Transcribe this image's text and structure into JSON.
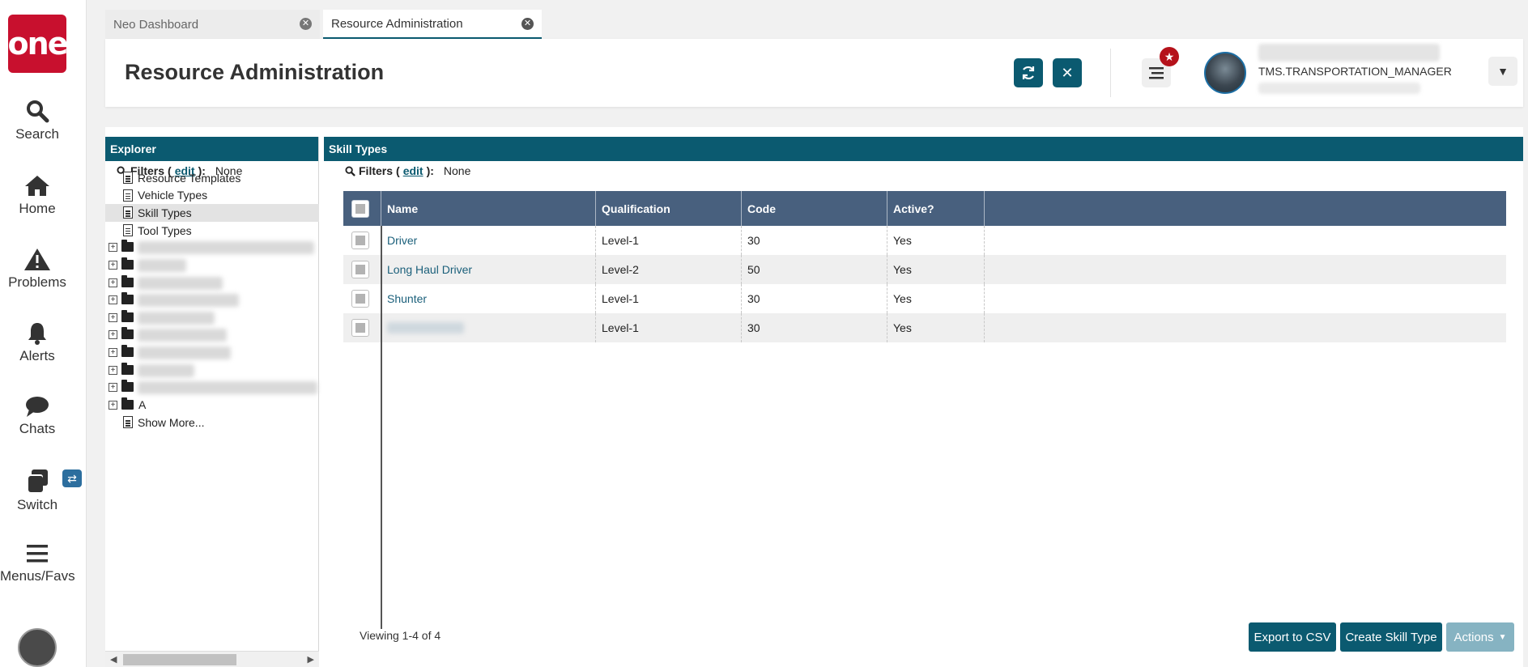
{
  "nav": {
    "logo": "one",
    "items": [
      {
        "label": "Search",
        "icon": "search-icon"
      },
      {
        "label": "Home",
        "icon": "home-icon"
      },
      {
        "label": "Problems",
        "icon": "warning-icon"
      },
      {
        "label": "Alerts",
        "icon": "bell-icon"
      },
      {
        "label": "Chats",
        "icon": "chat-icon"
      },
      {
        "label": "Switch",
        "icon": "switch-icon"
      },
      {
        "label": "Menus/Favs",
        "icon": "menu-icon"
      }
    ]
  },
  "tabs": [
    {
      "label": "Neo Dashboard",
      "active": false
    },
    {
      "label": "Resource Administration",
      "active": true
    }
  ],
  "header": {
    "title": "Resource Administration",
    "user_role": "TMS.TRANSPORTATION_MANAGER"
  },
  "explorer": {
    "title": "Explorer",
    "filters_label": "Filters",
    "filters_edit": "edit",
    "filters_value": "None",
    "items": [
      "Resource Templates",
      "Vehicle Types",
      "Skill Types",
      "Tool Types"
    ],
    "selected": "Skill Types",
    "folder_visible_label": "A",
    "show_more": "Show More..."
  },
  "skills": {
    "title": "Skill Types",
    "filters_label": "Filters",
    "filters_edit": "edit",
    "filters_value": "None",
    "columns": [
      "Name",
      "Qualification",
      "Code",
      "Active?"
    ],
    "rows": [
      {
        "name": "Driver",
        "qualification": "Level-1",
        "code": "30",
        "active": "Yes"
      },
      {
        "name": "Long Haul Driver",
        "qualification": "Level-2",
        "code": "50",
        "active": "Yes"
      },
      {
        "name": "Shunter",
        "qualification": "Level-1",
        "code": "30",
        "active": "Yes"
      },
      {
        "name": "",
        "qualification": "Level-1",
        "code": "30",
        "active": "Yes"
      }
    ],
    "viewing": "Viewing 1-4 of 4",
    "buttons": {
      "export": "Export to CSV",
      "create": "Create Skill Type",
      "actions": "Actions"
    }
  },
  "colors": {
    "brand_red": "#c8102e",
    "teal": "#0b5a70",
    "grid_header": "#48607e",
    "link": "#1a5f7a"
  }
}
